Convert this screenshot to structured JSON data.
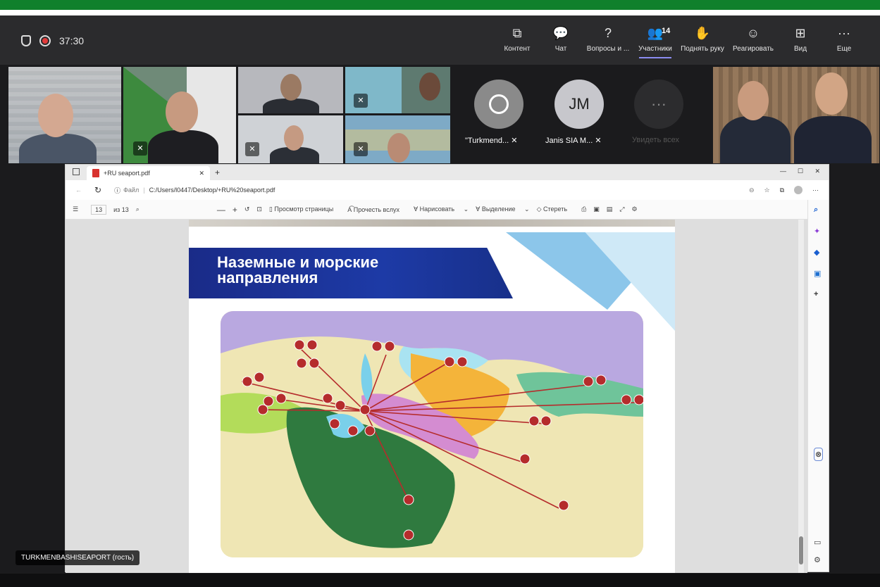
{
  "meeting": {
    "timer": "37:30",
    "toolbar": [
      {
        "label": "Контент",
        "icon": "share-icon",
        "glyph": "⧉"
      },
      {
        "label": "Чат",
        "icon": "chat-icon",
        "glyph": "💬"
      },
      {
        "label": "Вопросы и ...",
        "icon": "qa-icon",
        "glyph": "?"
      },
      {
        "label": "Участники",
        "icon": "people-icon",
        "glyph": "👥",
        "badge": "14",
        "active": true
      },
      {
        "label": "Поднять руку",
        "icon": "hand-icon",
        "glyph": "✋"
      },
      {
        "label": "Реагировать",
        "icon": "smile-icon",
        "glyph": "☺"
      },
      {
        "label": "Вид",
        "icon": "grid-icon",
        "glyph": "⊞"
      },
      {
        "label": "Еще",
        "icon": "more-icon",
        "glyph": "···"
      }
    ],
    "participants": [
      {
        "name": "\"Turkmend...",
        "initials": ""
      },
      {
        "name": "Janis SIA M...",
        "initials": "JM"
      },
      {
        "name": "Увидеть всех",
        "initials": "···"
      }
    ],
    "speaker_tag": "TURKMENBASHISEAPORT (гость)"
  },
  "browser": {
    "tab_title": "+RU seaport.pdf",
    "address_prefix": "Файл",
    "address": "C:/Users/l0447/Desktop/+RU%20seaport.pdf",
    "page_current": "13",
    "page_total": "из 13",
    "tools": {
      "page_view": "Просмотр страницы",
      "read_aloud": "Прочесть вслух",
      "draw": "Нарисовать",
      "highlight": "Выделение",
      "erase": "Стереть"
    }
  },
  "slide": {
    "title_line1": "Наземные и морские",
    "title_line2": "направления"
  },
  "colors": {
    "accent_green": "#10802c",
    "teams_bg": "#1b1b1d",
    "slide_blue": "#1a2b88",
    "active_underline": "#8b8cf0"
  }
}
